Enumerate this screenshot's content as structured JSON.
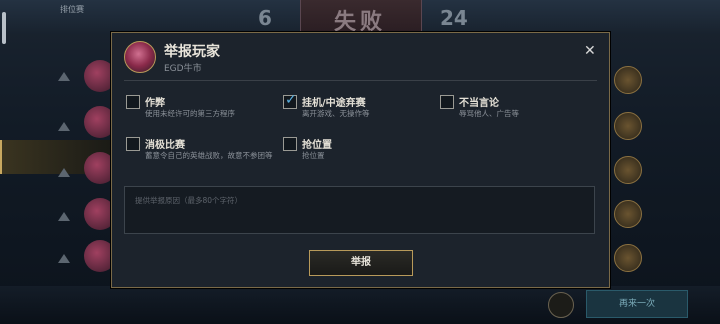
{
  "background": {
    "title": "排位赛",
    "subtitle": "",
    "score_left": "6",
    "score_right": "24",
    "result": "失败",
    "again_button": "再来一次"
  },
  "modal": {
    "title": "举报玩家",
    "player_name": "EGD牛市",
    "close_icon": "close-icon",
    "options": [
      {
        "label": "作弊",
        "desc": "使用未经许可的第三方程序",
        "checked": false
      },
      {
        "label": "挂机/中途弃赛",
        "desc": "离开游戏、无操作等",
        "checked": true
      },
      {
        "label": "不当言论",
        "desc": "辱骂他人、广告等",
        "checked": false
      },
      {
        "label": "消极比赛",
        "desc": "蓄意令自己的英雄战败，故意不参团等",
        "checked": false
      },
      {
        "label": "抢位置",
        "desc": "抢位置",
        "checked": false
      }
    ],
    "reason_placeholder": "提供举报原因（最多80个字符）",
    "reason_value": "",
    "submit_label": "举报"
  },
  "colors": {
    "accent_gold": "#b89a5a",
    "check_blue": "#5ab0e0",
    "modal_bg": "#1c232c"
  }
}
